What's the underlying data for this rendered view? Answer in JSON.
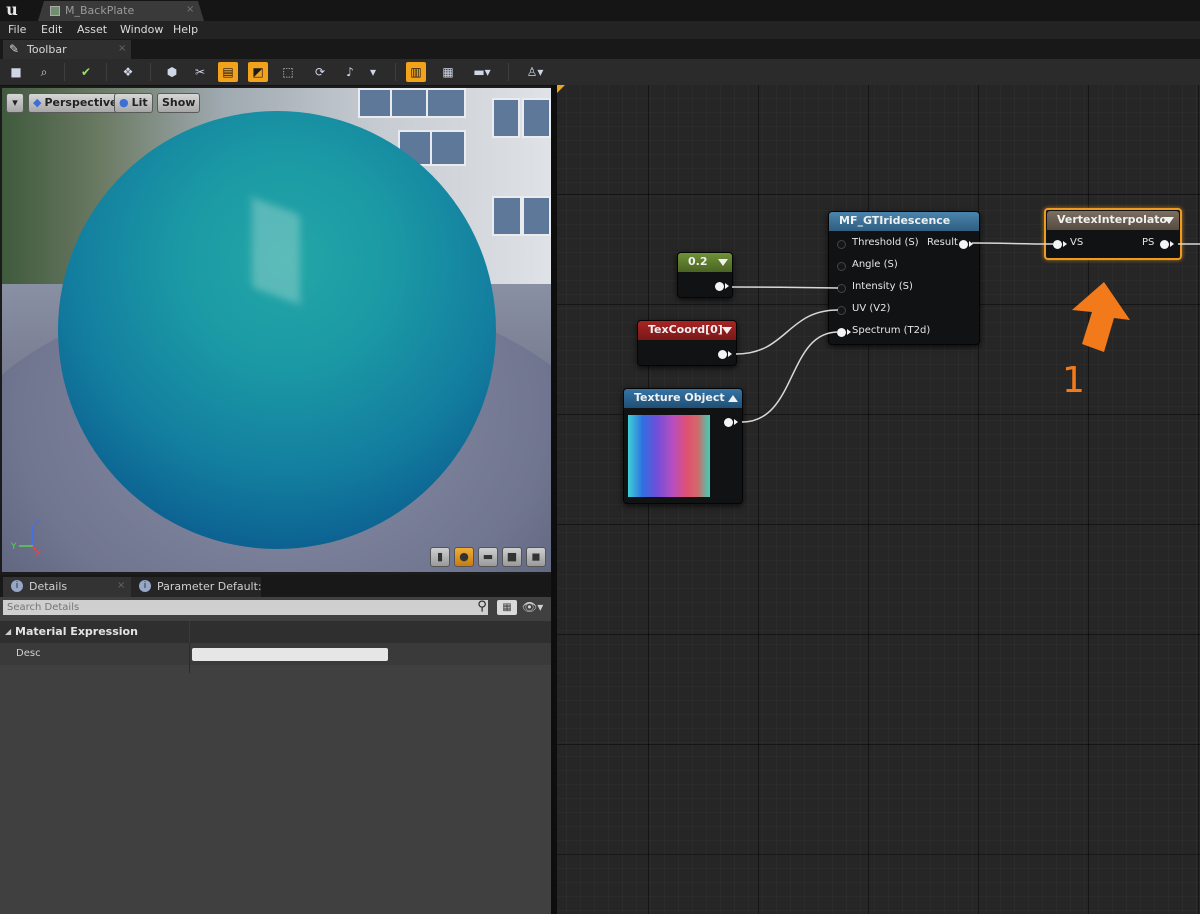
{
  "window": {
    "document_tab": "M_BackPlate",
    "document_tab_close": "×"
  },
  "menu": [
    "File",
    "Edit",
    "Asset",
    "Window",
    "Help"
  ],
  "toolbar_tab": {
    "label": "Toolbar",
    "close": "×"
  },
  "viewport": {
    "perspective_label": "Perspective",
    "lit_label": "Lit",
    "show_label": "Show",
    "axis_z": "Z",
    "axis_y": "Y",
    "axis_x": "X"
  },
  "details": {
    "tabs": [
      {
        "label": "Details",
        "close": "×"
      },
      {
        "label": "Parameter Default:",
        "close": "×"
      }
    ],
    "search_placeholder": "Search Details",
    "section_title": "Material Expression",
    "desc_label": "Desc",
    "desc_value": ""
  },
  "graph": {
    "nodes": {
      "constant": {
        "title": "0.2"
      },
      "texcoord": {
        "title": "TexCoord[0]"
      },
      "texture_object": {
        "title": "Texture Object"
      },
      "function": {
        "title": "MF_GTIridescence",
        "inputs": [
          "Threshold (S)",
          "Angle (S)",
          "Intensity (S)",
          "UV (V2)",
          "Spectrum (T2d)"
        ],
        "output": "Result"
      },
      "vertex_interpolator": {
        "title": "VertexInterpolator",
        "input": "VS",
        "output": "PS"
      }
    },
    "annotation_number": "1"
  },
  "colors": {
    "accent_orange": "#f2a21b",
    "annotation_orange": "#f27a1a",
    "constant_header": "#5c7a2d",
    "texcoord_header": "#8f1f1f",
    "function_header": "#3f6f94",
    "texture_header": "#2a5e86",
    "vertex_interpolator_header": "#6b6052"
  }
}
